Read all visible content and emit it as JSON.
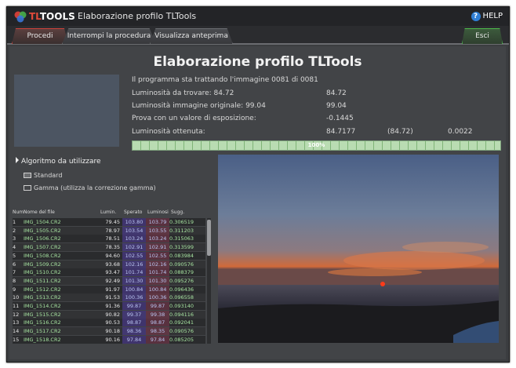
{
  "window": {
    "brand_tl": "TL",
    "brand_tools": "TOOLS",
    "title": "Elaborazione profilo TLTools",
    "help": "HELP",
    "help_glyph": "?"
  },
  "tabs": {
    "procedi": "Procedi",
    "interrompi": "Interrompi la procedura",
    "anteprima": "Visualizza anteprima",
    "esci": "Esci"
  },
  "header": "Elaborazione profilo TLTools",
  "status": {
    "line": "Il programma sta trattando l'immagine 0081 di 0081",
    "lum_target_label": "Luminosità da trovare: 84.72",
    "lum_target_value": "84.72",
    "lum_orig_label": "Luminosità immagine originale: 99.04",
    "lum_orig_value": "99.04",
    "exposure_label": "Prova con un valore di esposizione:",
    "exposure_value": "-0.1445",
    "obtained_label": "Luminosità ottenuta:",
    "obtained_value": "84.7177",
    "obtained_target": "(84.72)",
    "obtained_diff": "0.0022"
  },
  "progress": {
    "percent": 100,
    "label": "100%"
  },
  "algo": {
    "title": "Algoritmo da utilizzare",
    "opt_standard": "Standard",
    "opt_gamma": "Gamma (utilizza la correzione gamma)"
  },
  "table": {
    "headers": {
      "num": "Num",
      "name": "Nome del file",
      "lumin": "Lumin.",
      "sperato": "Sperato",
      "luminosi": "Luminosi",
      "sugg": "Sugg."
    },
    "rows": [
      {
        "num": "1",
        "name": "IMG_1504.CR2",
        "lumin": "79.45",
        "sperato": "103.80",
        "luminosi": "103.79",
        "sugg": "0.306519"
      },
      {
        "num": "2",
        "name": "IMG_1505.CR2",
        "lumin": "78.97",
        "sperato": "103.54",
        "luminosi": "103.55",
        "sugg": "0.311203"
      },
      {
        "num": "3",
        "name": "IMG_1506.CR2",
        "lumin": "78.51",
        "sperato": "103.24",
        "luminosi": "103.24",
        "sugg": "0.315063"
      },
      {
        "num": "4",
        "name": "IMG_1507.CR2",
        "lumin": "78.35",
        "sperato": "102.91",
        "luminosi": "102.91",
        "sugg": "0.313599"
      },
      {
        "num": "5",
        "name": "IMG_1508.CR2",
        "lumin": "94.60",
        "sperato": "102.55",
        "luminosi": "102.55",
        "sugg": "0.083984"
      },
      {
        "num": "6",
        "name": "IMG_1509.CR2",
        "lumin": "93.68",
        "sperato": "102.16",
        "luminosi": "102.16",
        "sugg": "0.090576"
      },
      {
        "num": "7",
        "name": "IMG_1510.CR2",
        "lumin": "93.47",
        "sperato": "101.74",
        "luminosi": "101.74",
        "sugg": "0.088379"
      },
      {
        "num": "8",
        "name": "IMG_1511.CR2",
        "lumin": "92.49",
        "sperato": "101.30",
        "luminosi": "101.30",
        "sugg": "0.095276"
      },
      {
        "num": "9",
        "name": "IMG_1512.CR2",
        "lumin": "91.97",
        "sperato": "100.84",
        "luminosi": "100.84",
        "sugg": "0.096436"
      },
      {
        "num": "10",
        "name": "IMG_1513.CR2",
        "lumin": "91.53",
        "sperato": "100.36",
        "luminosi": "100.36",
        "sugg": "0.096558"
      },
      {
        "num": "11",
        "name": "IMG_1514.CR2",
        "lumin": "91.36",
        "sperato": "99.87",
        "luminosi": "99.87",
        "sugg": "0.093140"
      },
      {
        "num": "12",
        "name": "IMG_1515.CR2",
        "lumin": "90.82",
        "sperato": "99.37",
        "luminosi": "99.38",
        "sugg": "0.094116"
      },
      {
        "num": "13",
        "name": "IMG_1516.CR2",
        "lumin": "90.53",
        "sperato": "98.87",
        "luminosi": "98.87",
        "sugg": "0.092041"
      },
      {
        "num": "14",
        "name": "IMG_1517.CR2",
        "lumin": "90.18",
        "sperato": "98.36",
        "luminosi": "98.35",
        "sugg": "0.090576"
      },
      {
        "num": "15",
        "name": "IMG_1518.CR2",
        "lumin": "90.16",
        "sperato": "97.84",
        "luminosi": "97.84",
        "sugg": "0.085205"
      }
    ]
  },
  "colors": {
    "accent_red": "#d0423a",
    "accent_green": "#4dbb4b",
    "filename_green": "#a6e3a0"
  }
}
